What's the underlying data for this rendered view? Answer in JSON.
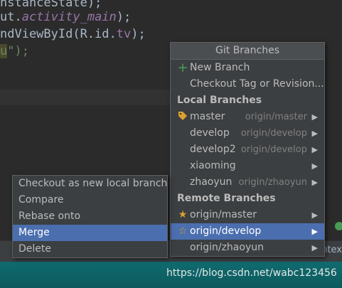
{
  "editor": {
    "lines": [
      {
        "a": "nstanceState);"
      },
      {
        "a": "ut.",
        "b": "activity_main",
        "c": ");"
      },
      {
        "a": "ndViewById(R.id.",
        "b": "tv",
        "c": ");"
      },
      {
        "a": "u",
        "b": "\");"
      }
    ]
  },
  "git_menu": {
    "title": "Git Branches",
    "new_branch": "New Branch",
    "checkout_tag": "Checkout Tag or Revision...",
    "local_header": "Local Branches",
    "local": [
      {
        "name": "master",
        "remote": "origin/master",
        "icon": "tag-icon"
      },
      {
        "name": "develop",
        "remote": "origin/develop"
      },
      {
        "name": "develop2",
        "remote": "origin/develop"
      },
      {
        "name": "xiaoming",
        "remote": ""
      },
      {
        "name": "zhaoyun",
        "remote": "origin/zhaoyun"
      }
    ],
    "remote_header": "Remote Branches",
    "remote": [
      {
        "name": "origin/master",
        "icon": "star-filled-icon"
      },
      {
        "name": "origin/develop",
        "icon": "star-outline-icon",
        "selected": true
      },
      {
        "name": "origin/zhaoyun"
      }
    ]
  },
  "context_menu": {
    "items": [
      "Checkout as new local branch",
      "Compare",
      "Rebase onto",
      "Merge",
      "Delete"
    ],
    "selected": "Merge"
  },
  "toolbar": {
    "text": "ntex"
  },
  "watermark": "https://blog.csdn.net/wabc123456",
  "colors": {
    "selection": "#4b6eaf",
    "menu_bg": "#3c3f41",
    "accent_green": "#499c54",
    "tag": "#e0a030",
    "star": "#e0a030"
  }
}
